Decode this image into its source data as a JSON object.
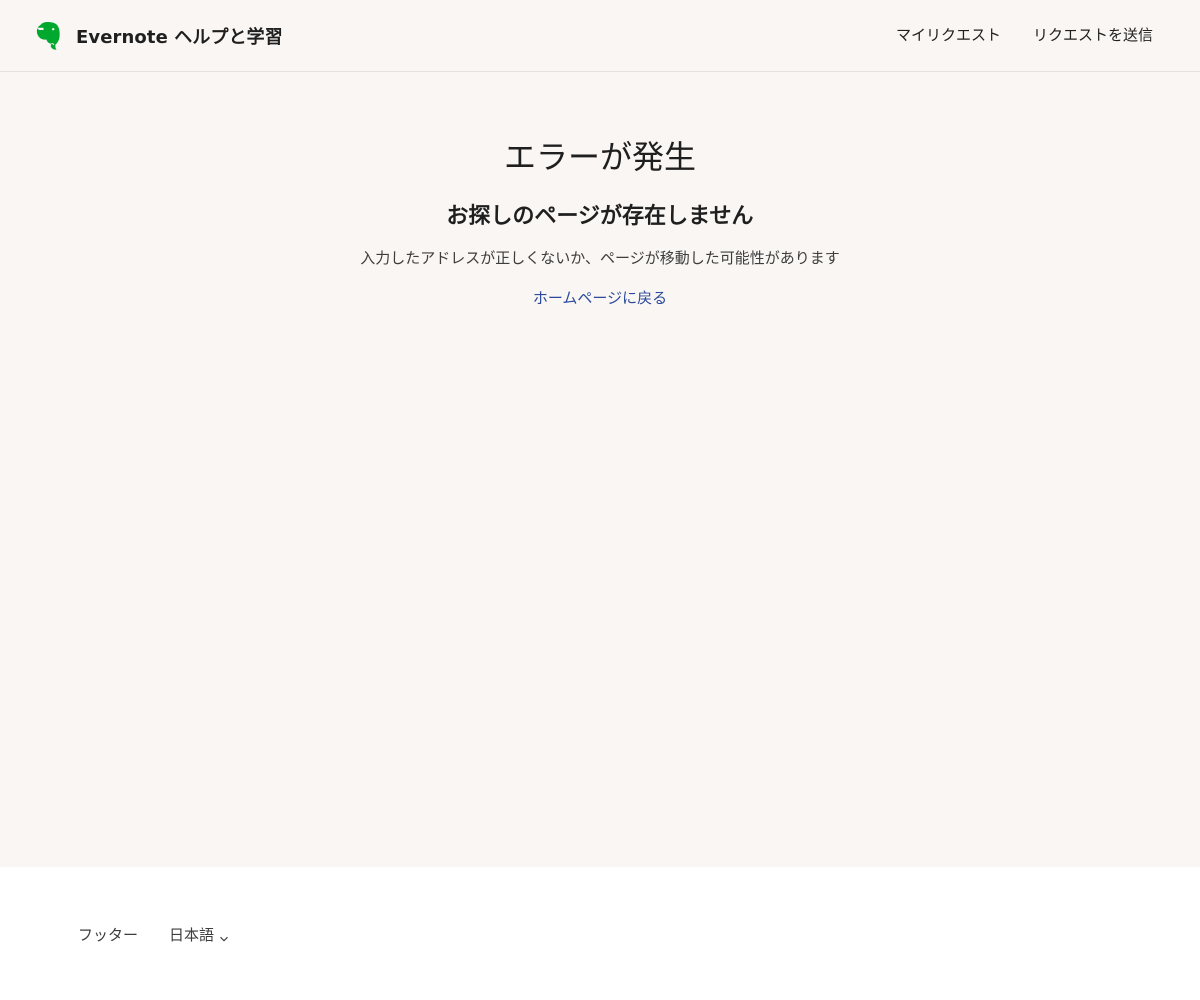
{
  "header": {
    "brand_title": "Evernote ヘルプと学習",
    "logo_icon": "evernote-elephant-icon",
    "brand_color": "#00a82d",
    "nav": [
      {
        "label": "マイリクエスト"
      },
      {
        "label": "リクエストを送信"
      }
    ]
  },
  "main": {
    "heading": "エラーが発生",
    "subheading": "お探しのページが存在しません",
    "message": "入力したアドレスが正しくないか、ページが移動した可能性があります",
    "home_link": "ホームページに戻る",
    "link_color": "#2c4a9c",
    "background_color": "#f9f6f3"
  },
  "footer": {
    "label": "フッター",
    "language": "日本語",
    "language_icon": "chevron-down-icon"
  }
}
